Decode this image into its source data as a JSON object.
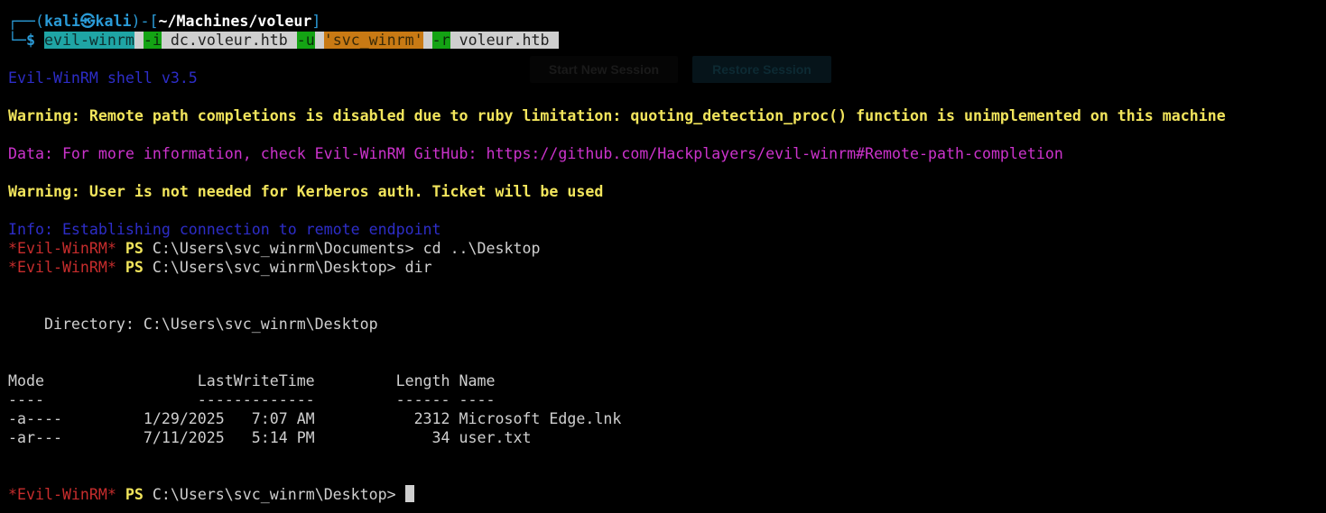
{
  "prompt": {
    "frame_top_left": "┌──(",
    "user_host": "kali㉿kali",
    "frame_mid": ")-[",
    "path": "~/Machines/voleur",
    "frame_close": "]",
    "frame_bottom": "└─",
    "dollar": "$",
    "command": {
      "cmd": "evil-winrm",
      "flag_i": "-i",
      "host": "dc.voleur.htb",
      "flag_u": "-u",
      "user": "'svc_winrm'",
      "flag_r": "-r",
      "realm": "voleur.htb"
    }
  },
  "output": {
    "shell_version": "Evil-WinRM shell v3.5",
    "warning_completion": "Warning: Remote path completions is disabled due to ruby limitation: quoting_detection_proc() function is unimplemented on this machine",
    "data_info": "Data: For more information, check Evil-WinRM GitHub: https://github.com/Hackplayers/evil-winrm#Remote-path-completion",
    "warning_kerberos": "Warning: User is not needed for Kerberos auth. Ticket will be used",
    "info_connect": "Info: Establishing connection to remote endpoint"
  },
  "ps_lines": [
    {
      "tag": "*Evil-WinRM*",
      "ps": "PS",
      "path": "C:\\Users\\svc_winrm\\Documents>",
      "cmd": "cd ..\\Desktop"
    },
    {
      "tag": "*Evil-WinRM*",
      "ps": "PS",
      "path": "C:\\Users\\svc_winrm\\Desktop>",
      "cmd": "dir"
    }
  ],
  "listing": {
    "directory": "    Directory: C:\\Users\\svc_winrm\\Desktop",
    "header": "Mode                 LastWriteTime         Length Name",
    "separator": "----                 -------------         ------ ----",
    "rows": [
      "-a----         1/29/2025   7:07 AM           2312 Microsoft Edge.lnk",
      "-ar---         7/11/2025   5:14 PM             34 user.txt"
    ]
  },
  "final_prompt": {
    "tag": "*Evil-WinRM*",
    "ps": "PS",
    "path": "C:\\Users\\svc_winrm\\Desktop>"
  },
  "ghost_buttons": {
    "start": "Start New Session",
    "restore": "Restore Session"
  },
  "colors": {
    "background": "#000000",
    "prompt_blue": "#2a9ad6",
    "info_blue": "#2d2dc8",
    "warning_yellow": "#f2e55c",
    "data_magenta": "#cc33cc",
    "tag_red": "#c72d2d",
    "text": "#cfcfcf"
  }
}
